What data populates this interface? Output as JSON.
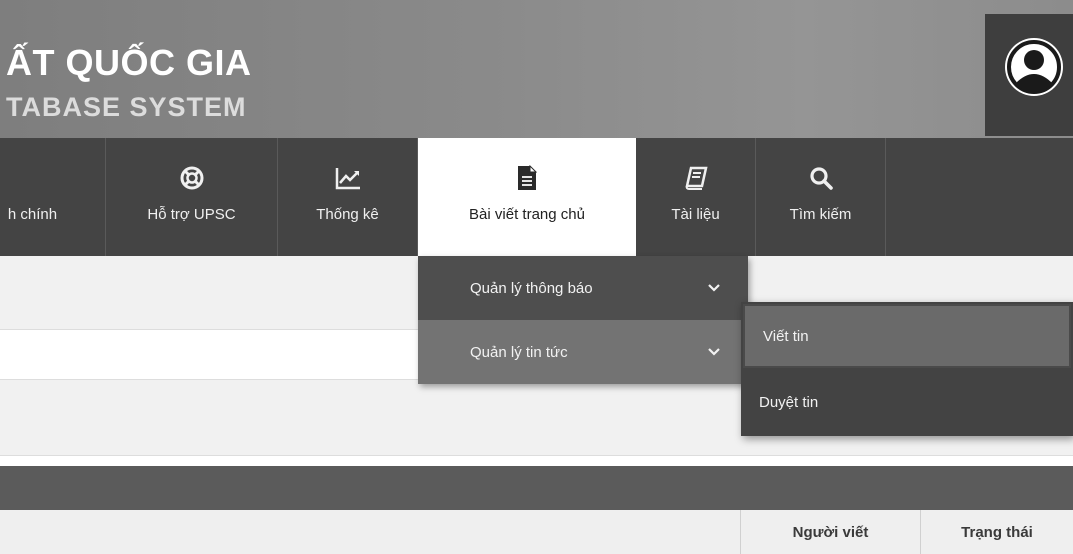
{
  "header": {
    "title_line1": "ẤT QUỐC GIA",
    "title_line2": "TABASE SYSTEM",
    "user_icon": "user-avatar-icon"
  },
  "nav": {
    "items": [
      {
        "label": "h chính",
        "icon": "none"
      },
      {
        "label": "Hỗ trợ UPSC",
        "icon": "lifebuoy-icon"
      },
      {
        "label": "Thống kê",
        "icon": "line-chart-icon"
      },
      {
        "label": "Bài viết trang chủ",
        "icon": "document-icon",
        "active": true
      },
      {
        "label": "Tài liệu",
        "icon": "book-icon"
      },
      {
        "label": "Tìm kiếm",
        "icon": "search-icon"
      }
    ]
  },
  "dropdown": {
    "items": [
      {
        "label": "Quản lý thông báo"
      },
      {
        "label": "Quản lý tin tức",
        "highlighted": true
      }
    ]
  },
  "subdropdown": {
    "items": [
      {
        "label": "Viết tin",
        "highlighted": true
      },
      {
        "label": "Duyệt tin"
      }
    ]
  },
  "table": {
    "columns": [
      "Người viết",
      "Trạng thái"
    ]
  },
  "colors": {
    "header_bg": "#8a8a8a",
    "nav_bg": "#444444",
    "dropdown_bg": "#4e4e4e",
    "highlight_bg": "#737373"
  }
}
